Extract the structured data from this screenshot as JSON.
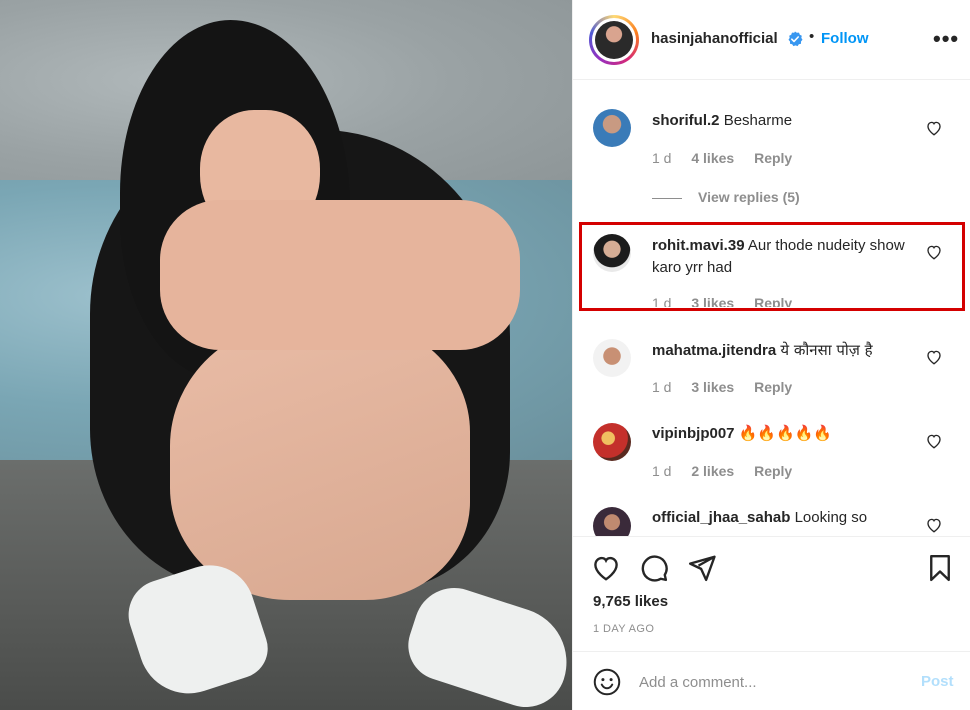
{
  "post": {
    "author": "hasinjahanofficial",
    "follow_label": "Follow",
    "separator": "•",
    "more_icon": "more-horizontal-icon"
  },
  "comments": [
    {
      "user": "shoriful.2",
      "text": "Besharme",
      "time": "1 d",
      "likes": "4 likes",
      "reply": "Reply",
      "view_replies": "View replies (5)"
    },
    {
      "user": "rohit.mavi.39",
      "text": "Aur thode nudeity show karo yrr had",
      "time": "1 d",
      "likes": "3 likes",
      "reply": "Reply",
      "highlighted": true
    },
    {
      "user": "mahatma.jitendra",
      "text": "ये कौनसा पोज़ है",
      "time": "1 d",
      "likes": "3 likes",
      "reply": "Reply"
    },
    {
      "user": "vipinbjp007",
      "text": "🔥🔥🔥🔥🔥",
      "time": "1 d",
      "likes": "2 likes",
      "reply": "Reply"
    },
    {
      "user": "official_jhaa_sahab",
      "text": "Looking so",
      "time": "",
      "likes": "",
      "reply": ""
    }
  ],
  "stats": {
    "likes": "9,765 likes",
    "date": "1 DAY AGO"
  },
  "composer": {
    "placeholder": "Add a comment...",
    "post_label": "Post"
  },
  "colors": {
    "accent": "#0095f6",
    "highlight_border": "#d40000",
    "muted": "#8e8e8e"
  }
}
